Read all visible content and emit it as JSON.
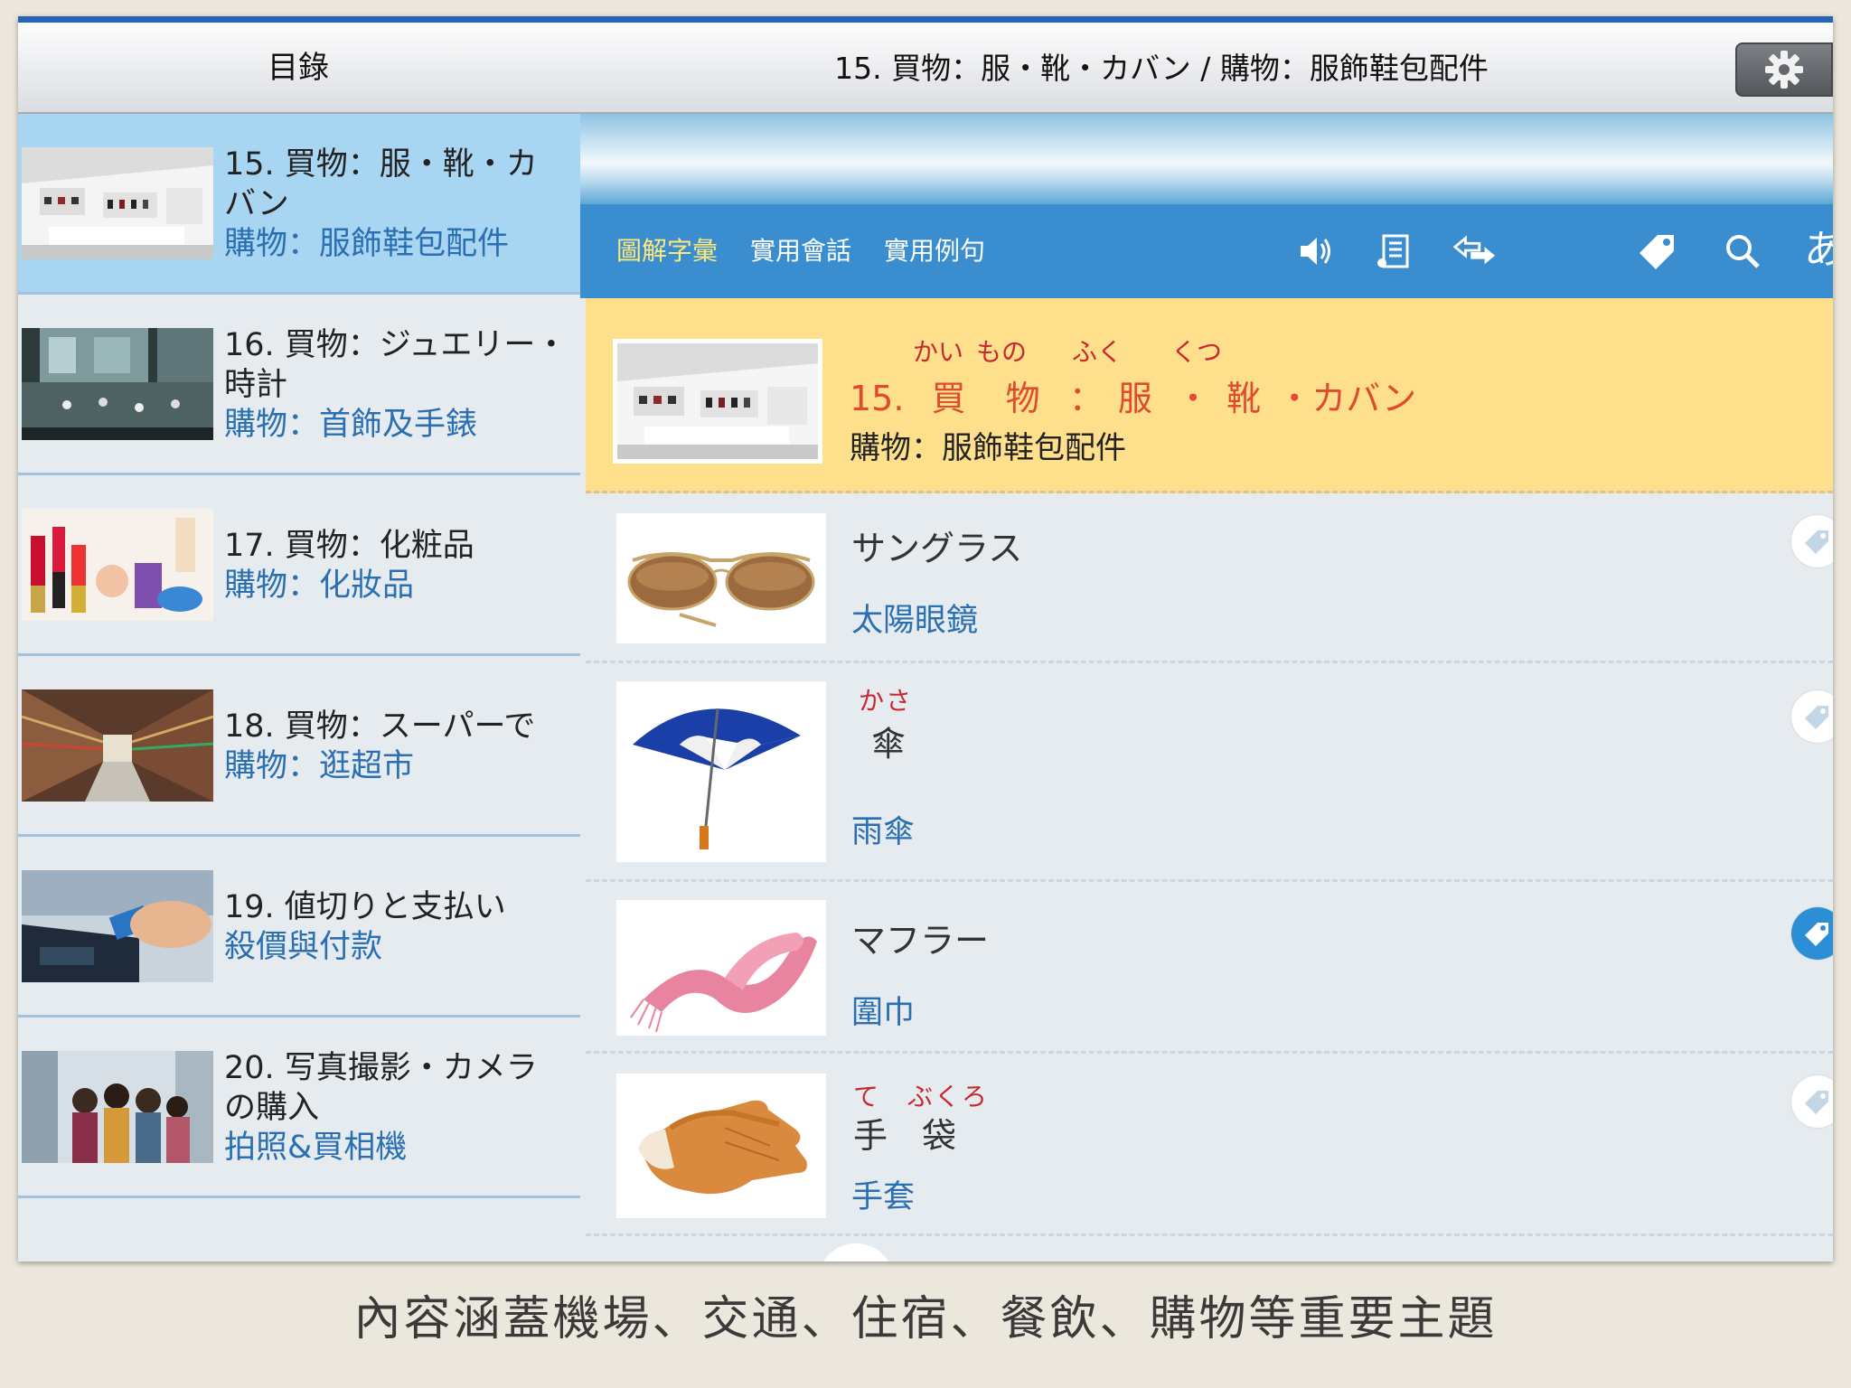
{
  "topbar": {
    "toc_title": "目錄",
    "main_title": "15. 買物：服・靴・カバン / 購物：服飾鞋包配件"
  },
  "sidebar": {
    "items": [
      {
        "jp": "15. 買物：服・靴・カバン",
        "zh": "購物：服飾鞋包配件",
        "active": true
      },
      {
        "jp": "16. 買物：ジュエリー・時計",
        "zh": "購物：首飾及手錶",
        "active": false
      },
      {
        "jp": "17. 買物：化粧品",
        "zh": "購物：化妝品",
        "active": false
      },
      {
        "jp": "18. 買物：スーパーで",
        "zh": "購物：逛超市",
        "active": false
      },
      {
        "jp": "19. 値切りと支払い",
        "zh": "殺價與付款",
        "active": false
      },
      {
        "jp": "20. 写真撮影・カメラの購入",
        "zh": "拍照&買相機",
        "active": false
      }
    ]
  },
  "tabs": [
    {
      "label": "圖解字彙",
      "active": true
    },
    {
      "label": "實用會話",
      "active": false
    },
    {
      "label": "實用例句",
      "active": false
    }
  ],
  "toolbar": {
    "icons": [
      "speaker-icon",
      "list-icon",
      "swap-arrows-icon",
      "tag-icon",
      "search-icon"
    ],
    "kana_label": "あ"
  },
  "header_card": {
    "number": "15.",
    "ruby": [
      "かい",
      "もの",
      "ふく",
      "くつ"
    ],
    "kanji": [
      "買",
      "物",
      "：",
      "服",
      "・",
      "靴",
      "・カバン"
    ],
    "subtitle": "購物：服飾鞋包配件"
  },
  "words": [
    {
      "ruby": "",
      "jp": "サングラス",
      "zh": "太陽眼鏡",
      "tagged": false
    },
    {
      "ruby": "かさ",
      "jp": "傘",
      "zh": "雨傘",
      "tagged": false
    },
    {
      "ruby": "",
      "jp": "マフラー",
      "zh": "圍巾",
      "tagged": true
    },
    {
      "ruby": "て　ぶくろ",
      "jp": "手　袋",
      "zh": "手套",
      "tagged": false
    }
  ],
  "caption": "內容涵蓋機場、交通、住宿、餐飲、購物等重要主題",
  "colors": {
    "accent_blue": "#3a8ed0",
    "header_yellow": "#fedf8c",
    "active_sidebar": "#a8d5f1",
    "link_blue": "#2a6fb2",
    "ruby_red": "#c7292f"
  }
}
